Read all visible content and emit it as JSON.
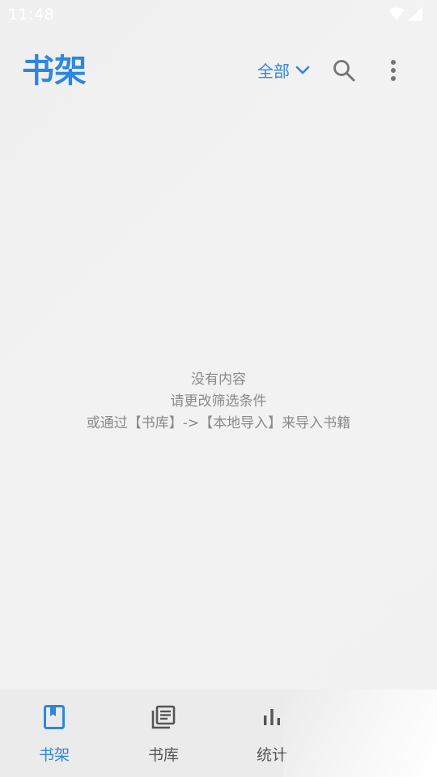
{
  "status_bar": {
    "time": "11:48",
    "icons": [
      "wifi-icon",
      "signal-icon"
    ]
  },
  "app_bar": {
    "title": "书架",
    "filter_label": "全部",
    "icons": [
      "chevron-down-icon",
      "search-icon",
      "more-vert-icon"
    ]
  },
  "empty_state": {
    "line1": "没有内容",
    "line2": "请更改筛选条件",
    "line3": "或通过【书库】->【本地导入】来导入书籍"
  },
  "bottom_nav": {
    "items": [
      {
        "label": "书架",
        "icon": "bookmark-book-icon",
        "active": true
      },
      {
        "label": "书库",
        "icon": "library-icon",
        "active": false
      },
      {
        "label": "统计",
        "icon": "bar-chart-icon",
        "active": false
      }
    ]
  },
  "colors": {
    "accent": "#2e86de",
    "inactive": "#555555",
    "muted_text": "#8a8a8a",
    "background": "#f1f1f1",
    "nav_background": "#ebebeb"
  }
}
